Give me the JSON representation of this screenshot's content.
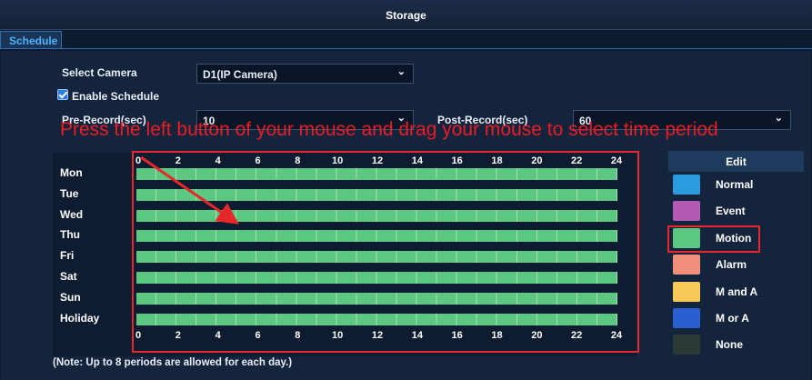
{
  "window": {
    "title": "Storage"
  },
  "tabs": [
    {
      "label": "Schedule",
      "active": true
    }
  ],
  "form": {
    "select_camera_label": "Select Camera",
    "select_camera_value": "D1(IP Camera)",
    "enable_schedule_label": "Enable Schedule",
    "enable_schedule_checked": true,
    "pre_record_label": "Pre-Record(sec)",
    "pre_record_value": "10",
    "post_record_label": "Post-Record(sec)",
    "post_record_value": "60"
  },
  "instruction": "Press the left button of your mouse and drag your mouse to select  time period",
  "schedule": {
    "hour_ticks": [
      "0",
      "2",
      "4",
      "6",
      "8",
      "10",
      "12",
      "14",
      "16",
      "18",
      "20",
      "22",
      "24"
    ],
    "days": [
      "Mon",
      "Tue",
      "Wed",
      "Thu",
      "Fri",
      "Sat",
      "Sun",
      "Holiday"
    ],
    "recording_type_all_days": "Motion",
    "coverage_hours": [
      0,
      24
    ]
  },
  "legend": {
    "edit_label": "Edit",
    "items": [
      {
        "label": "Normal",
        "color": "#2b9be0"
      },
      {
        "label": "Event",
        "color": "#b45ab4"
      },
      {
        "label": "Motion",
        "color": "#5bc781"
      },
      {
        "label": "Alarm",
        "color": "#f0907a"
      },
      {
        "label": "M and A",
        "color": "#f7c95a"
      },
      {
        "label": "M or A",
        "color": "#2b5fd1"
      },
      {
        "label": "None",
        "color": "#2b3a34"
      }
    ],
    "highlighted": "Motion"
  },
  "note": "(Note: Up to 8 periods are allowed for each day.)",
  "colors": {
    "accent": "#2d6fb1",
    "annotation": "#e6282a",
    "motion": "#5bc781"
  }
}
